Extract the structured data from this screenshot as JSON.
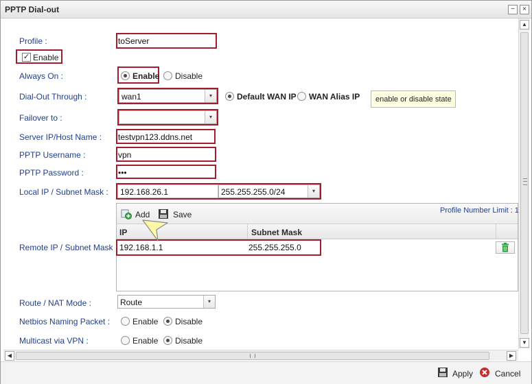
{
  "window": {
    "title": "PPTP Dial-out",
    "minimize_glyph": "−",
    "close_glyph": "×"
  },
  "form": {
    "profile": {
      "label": "Profile :",
      "value": "toServer"
    },
    "enable_checkbox": {
      "label": "Enable",
      "checked": true,
      "glyph": "✓"
    },
    "always_on": {
      "label": "Always On :",
      "options": [
        "Enable",
        "Disable"
      ],
      "selected": "Enable"
    },
    "dial_out_through": {
      "label": "Dial-Out Through :",
      "value": "wan1",
      "options": [
        "Default WAN IP",
        "WAN Alias IP"
      ],
      "selected": "Default WAN IP"
    },
    "failover_to": {
      "label": "Failover to :",
      "value": ""
    },
    "server": {
      "label": "Server IP/Host Name :",
      "value": "testvpn123.ddns.net"
    },
    "username": {
      "label": "PPTP Username :",
      "value": "vpn"
    },
    "password": {
      "label": "PPTP Password :",
      "value": "•••"
    },
    "local_ip": {
      "label": "Local IP / Subnet Mask :",
      "ip": "192.168.26.1",
      "mask": "255.255.255.0/24"
    },
    "remote_ip": {
      "label": "Remote IP / Subnet Mask :"
    },
    "route_nat_mode": {
      "label": "Route / NAT Mode :",
      "value": "Route"
    },
    "netbios": {
      "label": "Netbios Naming Packet :",
      "options": [
        "Enable",
        "Disable"
      ],
      "selected": "Disable"
    },
    "multicast": {
      "label": "Multicast via VPN :",
      "options": [
        "Enable",
        "Disable"
      ],
      "selected": "Disable"
    }
  },
  "tooltip": "enable or disable state",
  "grid": {
    "add_label": "Add",
    "save_label": "Save",
    "limit_label": "Profile Number Limit : 1",
    "columns": [
      "IP",
      "Subnet Mask"
    ],
    "rows": [
      {
        "ip": "192.168.1.1",
        "mask": "255.255.255.0"
      }
    ]
  },
  "footer": {
    "apply_label": "Apply",
    "cancel_label": "Cancel"
  },
  "icons": {
    "dropdown": "▾",
    "scroll_up": "▲",
    "scroll_down": "▼",
    "scroll_left": "◀",
    "scroll_right": "▶"
  },
  "colors": {
    "label_blue": "#1f3f8f",
    "highlight_red": "#a31c2c",
    "tooltip_bg": "#ffffe1",
    "trash_green": "#2e9a3e",
    "cancel_red": "#c62b2b"
  }
}
